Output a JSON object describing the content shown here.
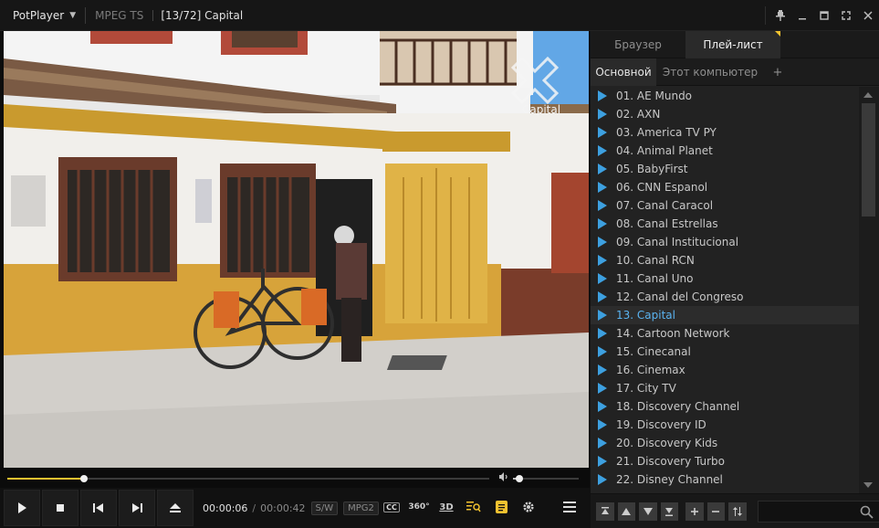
{
  "titlebar": {
    "app_name": "PotPlayer",
    "format": "MPEG TS",
    "title": "[13/72] Capital",
    "window_buttons": [
      "pin-icon",
      "minimize-icon",
      "maximize-icon",
      "fullscreen-icon",
      "close-icon"
    ]
  },
  "video": {
    "watermark": "Capital"
  },
  "seek": {
    "progress_fraction": 0.16,
    "volume_fraction": 0.1
  },
  "controls": {
    "time_current": "00:00:06",
    "time_separator": "/",
    "time_total": "00:00:42",
    "badge_sw": "S/W",
    "badge_codec": "MPG2",
    "cc_label": "CC",
    "vr_label": "360°",
    "threed_label": "3D"
  },
  "panel": {
    "tabs": [
      "Браузер",
      "Плей-лист"
    ],
    "subtabs": [
      "Основной",
      "Этот компьютер",
      "+"
    ],
    "items": [
      "01. AE Mundo",
      "02. AXN",
      "03. America TV PY",
      "04. Animal Planet",
      "05. BabyFirst",
      "06. CNN Espanol",
      "07. Canal Caracol",
      "08. Canal Estrellas",
      "09. Canal Institucional",
      "10. Canal RCN",
      "11. Canal Uno",
      "12. Canal del Congreso",
      "13. Capital",
      "14. Cartoon Network",
      "15. Cinecanal",
      "16. Cinemax",
      "17. City TV",
      "18. Discovery Channel",
      "19. Discovery ID",
      "20. Discovery Kids",
      "21. Discovery Turbo",
      "22. Disney Channel"
    ],
    "current_index": 12,
    "search_placeholder": "",
    "accent": "#f2c230",
    "play_icon_color": "#3da0e0"
  }
}
